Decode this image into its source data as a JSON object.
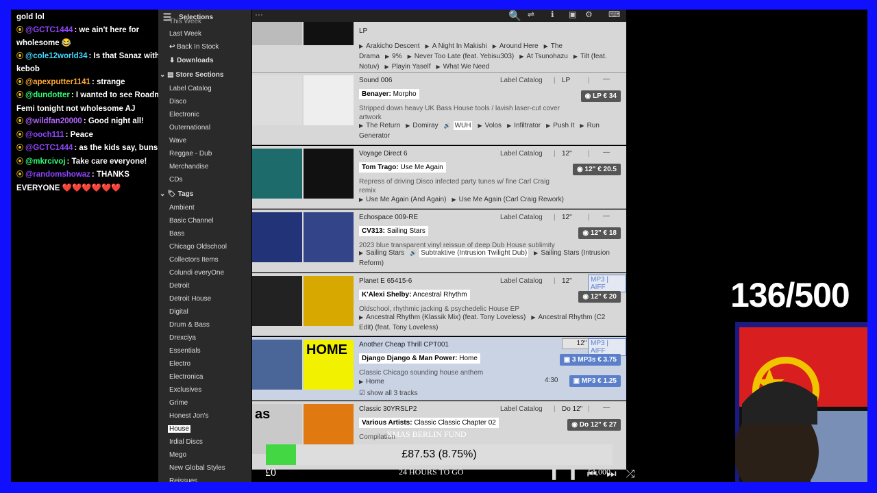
{
  "chat": [
    {
      "user": "",
      "text": "gold lol",
      "color": "#ffffff"
    },
    {
      "user": "@GCTC1444",
      "text": ": we ain't here for wholesome 😂",
      "color": "#9146ff"
    },
    {
      "user": "@cole12world34",
      "text": ": Is that Sanaz with a kebob",
      "color": "#44d8ff"
    },
    {
      "user": "@apexputter1141",
      "text": ": strange",
      "color": "#ffaa33"
    },
    {
      "user": "@dundotter",
      "text": ": I wanted to see Roadman Femi tonight not wholesome AJ",
      "color": "#33ff77"
    },
    {
      "user": "@wildfan20000",
      "text": ": Good night all!",
      "color": "#b466ff"
    },
    {
      "user": "@ooch111",
      "text": ": Peace",
      "color": "#9146ff"
    },
    {
      "user": "@GCTC1444",
      "text": ": as the kids say, buns",
      "color": "#9146ff"
    },
    {
      "user": "@mkrcivoj",
      "text": ": Take care everyone!",
      "color": "#33ff77"
    },
    {
      "user": "@randomshowaz",
      "text": ": THANKS EVERYONE ❤️❤️❤️❤️❤️❤️",
      "color": "#9146ff"
    }
  ],
  "sidebar": {
    "header": "Selections",
    "this_week": "This Week",
    "last_week": "Last Week",
    "back_in_stock": "Back In Stock",
    "downloads": "Downloads",
    "store_sections": "Store Sections",
    "sections": [
      "Label Catalog",
      "Disco",
      "Electronic",
      "Outernational",
      "Wave",
      "Reggae - Dub",
      "Merchandise",
      "CDs"
    ],
    "tags_title": "Tags",
    "tags": [
      "Ambient",
      "Basic Channel",
      "Bass",
      "Chicago Oldschool",
      "Collectors Items",
      "Colundi everyOne",
      "Detroit",
      "Detroit House",
      "Digital",
      "Drum & Bass",
      "Drexciya",
      "Essentials",
      "Electro",
      "Electronica",
      "Exclusives",
      "Grime",
      "Honest Jon's",
      "House",
      "Irdial Discs",
      "Mego",
      "New Global Styles",
      "Reissues"
    ],
    "selected_tag": "House"
  },
  "top_partial": {
    "format": "LP",
    "tracks": [
      "Arakicho Descent",
      "A Night In Makishi",
      "Around Here",
      "The Drama",
      "9%",
      "Never Too Late (feat. Yebisu303)",
      "At Tsunohazu",
      "Tilt (feat. Notuv)",
      "Playin Yaself",
      "What We Need"
    ]
  },
  "rows": [
    {
      "code": "Sound 006",
      "lc": "Label Catalog",
      "fmt": "LP",
      "artist": "Benayer:",
      "title": "Morpho",
      "desc": "Stripped down heavy UK Bass House tools / lavish laser-cut cover artwork",
      "price": "LP € 34",
      "tracks": [
        "The Return",
        "Domiray",
        "WUH",
        "Volos",
        "Infiltrator",
        "Push It",
        "Run Generator"
      ],
      "active": "WUH"
    },
    {
      "code": "Voyage Direct 6",
      "lc": "Label Catalog",
      "fmt": "12\"",
      "artist": "Tom Trago:",
      "title": "Use Me Again",
      "desc": "Repress of driving Disco infected party tunes w/ fine Carl Craig remix",
      "price": "12\" € 20.5",
      "tracks": [
        "Use Me Again (And Again)",
        "Use Me Again (Carl Craig Rework)"
      ]
    },
    {
      "code": "Echospace 009-RE",
      "lc": "Label Catalog",
      "fmt": "12\"",
      "artist": "CV313:",
      "title": "Sailing Stars",
      "desc": "2023 blue transparent vinyl reissue of deep Dub House sublimity",
      "price": "12\" € 18",
      "tracks": [
        "Sailing Stars",
        "Subtraktive (Intrusion Twilight Dub)",
        "Sailing Stars (Intrusion Reform)"
      ],
      "active": "Subtraktive (Intrusion Twilight Dub)"
    },
    {
      "code": "Planet E 65415-6",
      "lc": "Label Catalog",
      "fmt": "12\"",
      "mp3": "MP3 | AIFF",
      "artist": "K'Alexi Shelby:",
      "title": "Ancestral Rhythm",
      "desc": "Oldschool, rhythmic jacking & psychedelic House EP",
      "price": "12\" € 20",
      "tracks": [
        "Ancestral Rhythm (Klassik Mix) (feat. Tony Loveless)",
        "Ancestral Rhythm (C2 Edit) (feat. Tony Loveless)"
      ]
    },
    {
      "code": "Another Cheap Thrill CPT001",
      "fmt": "12\"",
      "mp3": "MP3 | AIFF",
      "artist": "Django Django & Man Power:",
      "title": "Home",
      "desc": "Classic Chicago sounding house anthem",
      "price": "3 MP3s € 3.75",
      "track": "Home",
      "duration": "4:30",
      "track_price": "MP3 € 1.25",
      "show_all": "show all 3 tracks",
      "cover_text": "HOME"
    },
    {
      "code": "Classic 30YRSLP2",
      "lc": "Label Catalog",
      "fmt": "Do 12\"",
      "artist": "Various Artists:",
      "title": "Classic Classic Chapter 02",
      "desc": "Compilation",
      "price": "Do 12\" € 27",
      "cover_text": "as"
    }
  ],
  "overlay": {
    "counter": "136/500",
    "fund_title": "XMAS BERLIN FUND",
    "amount": "£87.53 (8.75%)",
    "progress": 0.0875,
    "hours": "24 HOURS TO GO",
    "min": "£0",
    "max": "£1,000"
  }
}
